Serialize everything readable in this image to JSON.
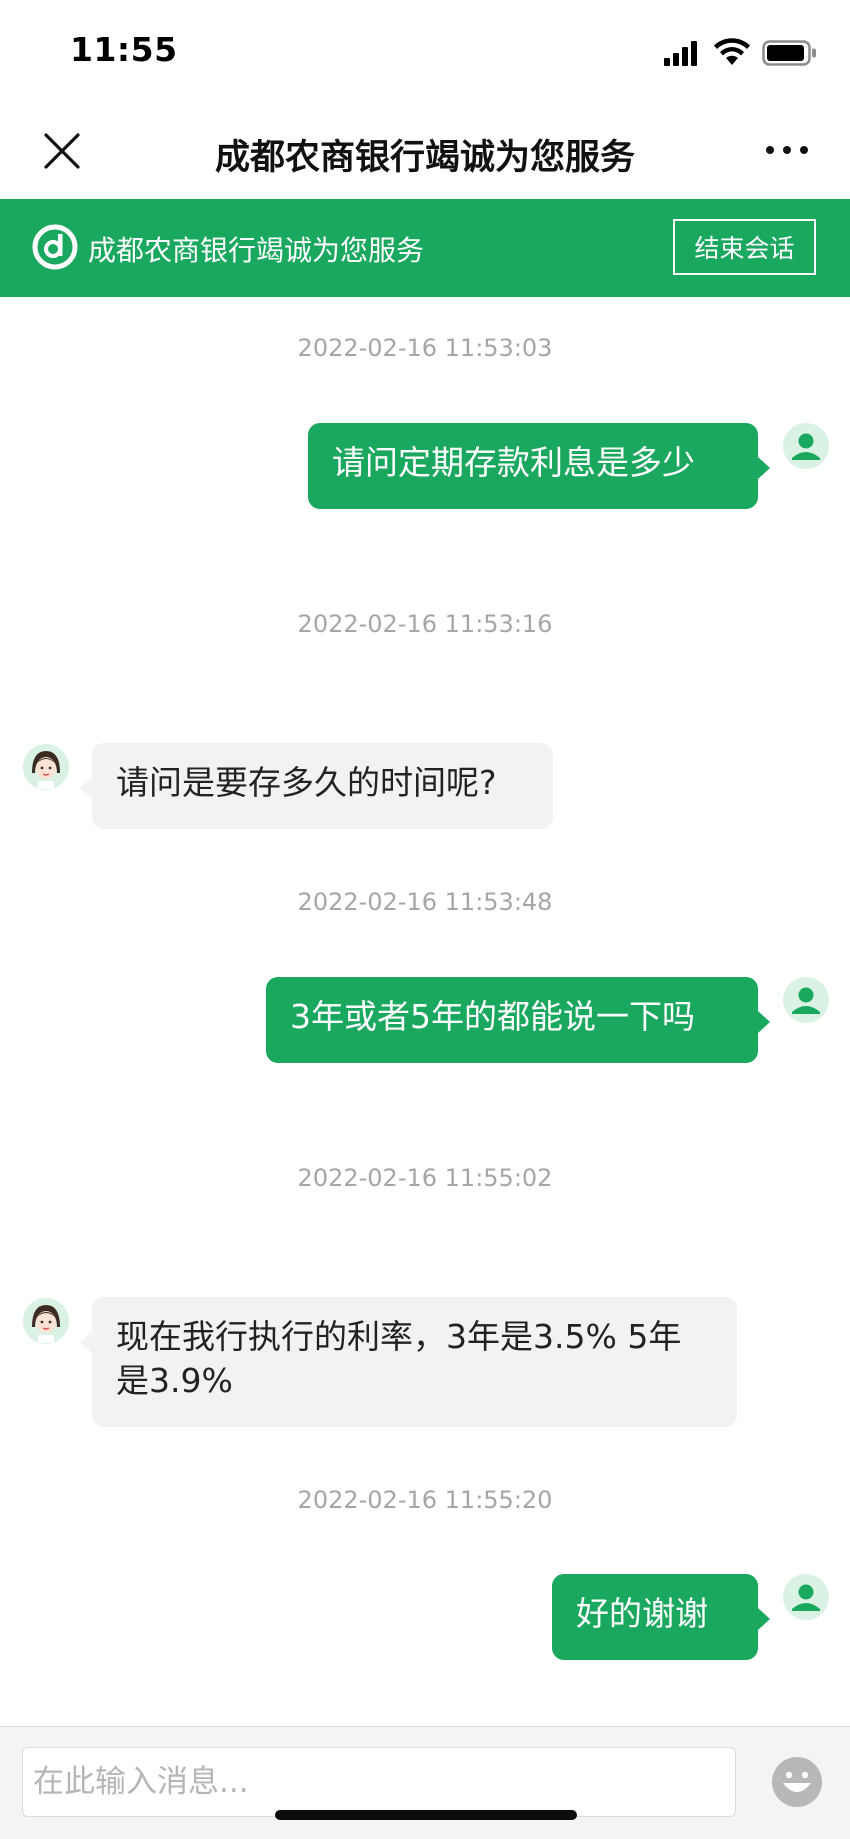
{
  "status_bar": {
    "time": "11:55"
  },
  "nav": {
    "title": "成都农商银行竭诚为您服务"
  },
  "banner": {
    "text": "成都农商银行竭诚为您服务",
    "end_session_label": "结束会话",
    "brand_color": "#1aa85f"
  },
  "chat": {
    "messages": [
      {
        "timestamp": "2022-02-16 11:53:03",
        "sender": "user",
        "text": "请问定期存款利息是多少"
      },
      {
        "timestamp": "2022-02-16 11:53:16",
        "sender": "agent",
        "text": "请问是要存多久的时间呢?"
      },
      {
        "timestamp": "2022-02-16 11:53:48",
        "sender": "user",
        "text": "3年或者5年的都能说一下吗"
      },
      {
        "timestamp": "2022-02-16 11:55:02",
        "sender": "agent",
        "text": "现在我行执行的利率，3年是3.5% 5年是3.9%"
      },
      {
        "timestamp": "2022-02-16 11:55:20",
        "sender": "user",
        "text": "好的谢谢"
      }
    ]
  },
  "input": {
    "placeholder": "在此输入消息..."
  },
  "icons": {
    "close": "close-icon",
    "more": "more-icon",
    "logo": "bank-logo-icon",
    "user_avatar": "user-avatar-icon",
    "agent_avatar": "agent-avatar-icon",
    "emoji": "emoji-icon"
  }
}
